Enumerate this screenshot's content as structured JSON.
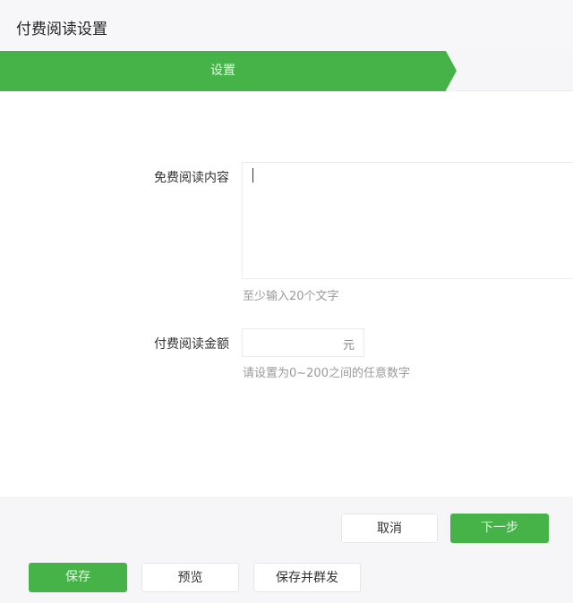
{
  "header": {
    "title": "付费阅读设置"
  },
  "steps": [
    {
      "label": "设置",
      "active": true
    }
  ],
  "form": {
    "free_content": {
      "label": "免费阅读内容",
      "value": "",
      "hint": "至少输入20个文字"
    },
    "amount": {
      "label": "付费阅读金额",
      "value": "",
      "unit": "元",
      "hint": "请设置为0~200之间的任意数字"
    }
  },
  "dialog_actions": {
    "cancel": "取消",
    "next": "下一步"
  },
  "page_actions": {
    "save": "保存",
    "preview": "预览",
    "save_and_send": "保存并群发"
  },
  "colors": {
    "accent": "#46b348"
  }
}
